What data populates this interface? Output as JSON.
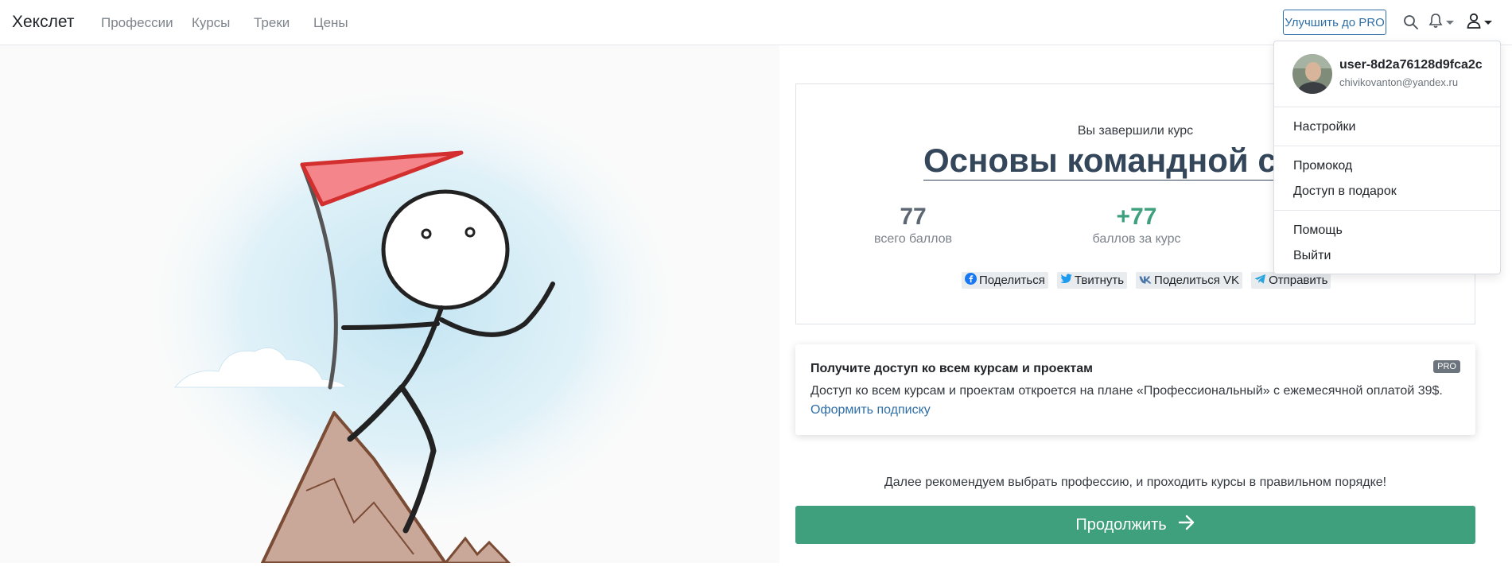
{
  "navbar": {
    "brand": "Хекслет",
    "links": [
      "Профессии",
      "Курсы",
      "Треки",
      "Цены"
    ],
    "pro_button": "Улучшить до PRO"
  },
  "result": {
    "completed_label": "Вы завершили курс",
    "course_title": "Основы командной строки",
    "total_points": "77",
    "total_points_label": "всего баллов",
    "course_points": "+77",
    "course_points_label": "баллов за курс",
    "share": {
      "facebook": "Поделиться",
      "twitter": "Твитнуть",
      "vk": "Поделиться VK",
      "telegram": "Отправить"
    }
  },
  "pro_card": {
    "title": "Получите доступ ко всем курсам и проектам",
    "badge": "PRO",
    "text": "Доступ ко всем курсам и проектам откроется на плане «Профессиональный» с ежемесячной оплатой 39$.",
    "link": "Оформить подписку"
  },
  "recommendation": "Далее рекомендуем выбрать профессию, и проходить курсы в правильном порядке!",
  "continue_button": "Продолжить",
  "user_menu": {
    "username": "user-8d2a76128d9fca2c",
    "email": "chivikovanton@yandex.ru",
    "items": [
      "Настройки",
      "Промокод",
      "Доступ в подарок",
      "Помощь",
      "Выйти"
    ]
  },
  "colors": {
    "accent_green": "#3fa07d",
    "link_blue": "#2f6fa7",
    "title_dark": "#34465a",
    "flag_red": "#e8383d"
  }
}
